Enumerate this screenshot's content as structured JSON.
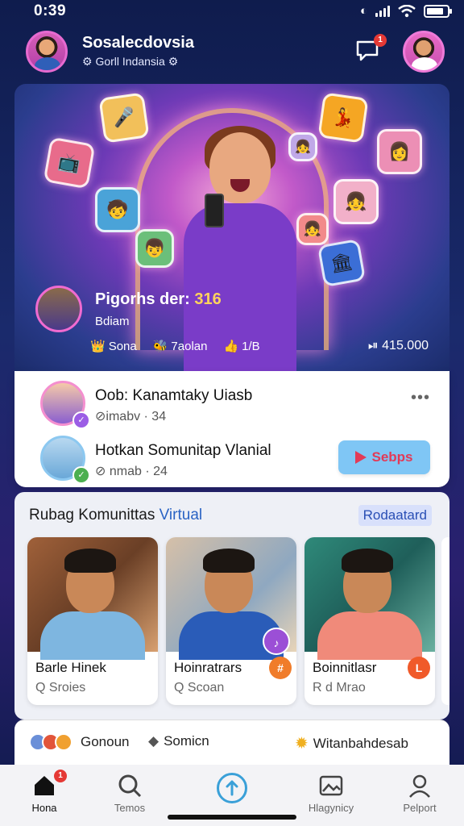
{
  "status_bar": {
    "time": "0:39"
  },
  "header": {
    "title": "Sosalecdovsia",
    "subtitle": "⚙ Gorll Indansia ⚙",
    "notification_count": "1"
  },
  "hero": {
    "label_prefix": "Pigorhs der: ",
    "label_number": "316",
    "sub": "Bdiam",
    "stats": [
      {
        "icon": "👑",
        "text": "Sona"
      },
      {
        "icon": "🐝",
        "text": "7aolan"
      },
      {
        "icon": "👍",
        "text": "1/B"
      }
    ],
    "views": "⏯ 415.000"
  },
  "list": [
    {
      "title": "Oob: Kanamtaky Uiasb",
      "meta": "⊘imabv · 34",
      "action": "•••"
    },
    {
      "title": "Hotkan Somunitap Vlanial",
      "meta": "⊘ nmab · 24",
      "action": "Sebps"
    }
  ],
  "section": {
    "title_prefix": "Rubag Komunittas ",
    "title_accent": "Virtual",
    "tag": "Rodaatard",
    "cards": [
      {
        "name": "Barle Hinek",
        "meta": "Q Sroies",
        "badge": ""
      },
      {
        "name": "Hoinratrars",
        "meta": "Q Scoan",
        "badge": "♪"
      },
      {
        "name": "Boinnitlasr",
        "meta": "R d Mrao",
        "badge": "L"
      }
    ]
  },
  "strip": {
    "item1": "Gonoun",
    "item2": "Somicn",
    "item3": "Witanbahdesab"
  },
  "tabs": [
    {
      "label": "Hona",
      "badge": "1"
    },
    {
      "label": "Temos",
      "badge": ""
    },
    {
      "label": "",
      "badge": ""
    },
    {
      "label": "Hlagynicy",
      "badge": ""
    },
    {
      "label": "Pelport",
      "badge": ""
    }
  ],
  "colors": {
    "accent": "#2a63c4",
    "cta_bg": "#7fc6f5",
    "cta_text": "#e23a57",
    "badge": "#e53935"
  }
}
